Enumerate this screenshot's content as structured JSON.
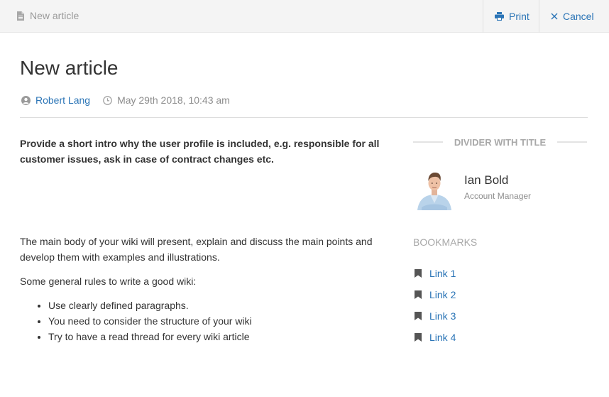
{
  "header": {
    "doc_title": "New article",
    "print_label": "Print",
    "cancel_label": "Cancel"
  },
  "article": {
    "title": "New article",
    "author": "Robert Lang",
    "date": "May 29th 2018, 10:43 am",
    "intro": "Provide a short intro why the user profile is included, e.g. responsible for all customer issues, ask in case of contract changes etc.",
    "body_paragraph": "The main body of your wiki will present, explain and discuss the main points and develop them with examples and illustrations.",
    "rules_intro": "Some general rules to write a good wiki:",
    "rules": [
      "Use clearly defined paragraphs.",
      "You need to consider the structure of your wiki",
      "Try to have a read thread for every wiki article"
    ]
  },
  "sidebar": {
    "divider_title": "DIVIDER WITH TITLE",
    "person": {
      "name": "Ian Bold",
      "role": "Account Manager"
    },
    "bookmarks_title": "BOOKMARKS",
    "bookmarks": [
      "Link 1",
      "Link 2",
      "Link 3",
      "Link 4"
    ]
  },
  "icons": {
    "doc": "document-icon",
    "print": "printer-icon",
    "cancel": "close-icon",
    "author": "user-circle-icon",
    "date": "clock-icon",
    "bookmark": "bookmark-icon"
  },
  "colors": {
    "link": "#2a74b6",
    "muted": "#8d8d8d",
    "topbar": "#f4f4f4"
  }
}
